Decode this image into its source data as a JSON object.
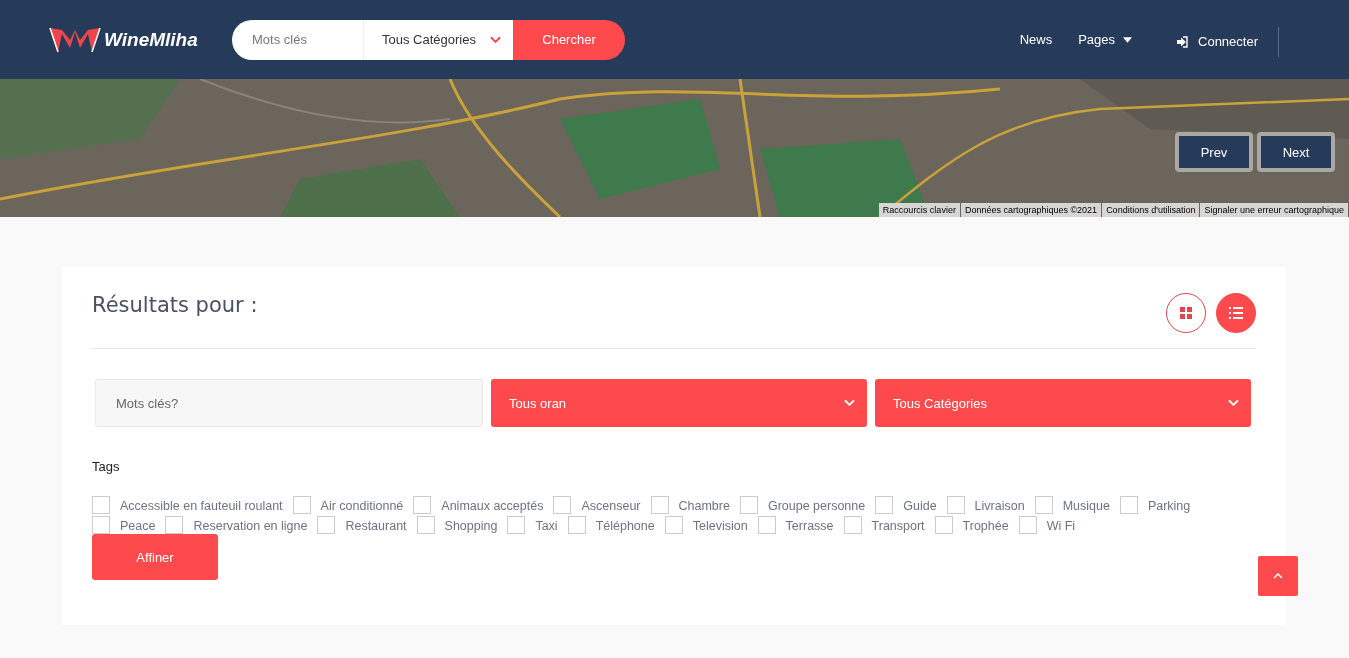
{
  "header": {
    "logo": "WineMliha",
    "search": {
      "placeholder": "Mots clés",
      "category": "Tous Catégories",
      "button": "Chercher"
    },
    "nav": [
      {
        "label": "News",
        "kind": "link"
      },
      {
        "label": "Pages",
        "kind": "dropdown"
      }
    ],
    "login": "Connecter"
  },
  "map": {
    "buttons": [
      "Prev",
      "Next"
    ],
    "attribution": [
      "Raccourcis clavier",
      "Données cartographiques ©2021",
      "Conditions d'utilisation",
      "Signaler une erreur cartographique"
    ]
  },
  "results": {
    "title": "Résultats pour :",
    "views": [
      {
        "kind": "grid",
        "selected": false
      },
      {
        "kind": "list",
        "selected": true
      }
    ],
    "filters": {
      "keyword_placeholder": "Mots clés?",
      "location": "Tous oran",
      "category": "Tous Catégories"
    },
    "tags_label": "Tags",
    "tags": [
      {
        "label": "Accessible en fauteuil roulant",
        "checked": false
      },
      {
        "label": "Air conditionné",
        "checked": false
      },
      {
        "label": "Animaux acceptés",
        "checked": false
      },
      {
        "label": "Ascenseur",
        "checked": false
      },
      {
        "label": "Chambre",
        "checked": false
      },
      {
        "label": "Groupe personne",
        "checked": false
      },
      {
        "label": "Guide",
        "checked": false
      },
      {
        "label": "Livraison",
        "checked": false
      },
      {
        "label": "Musique",
        "checked": false
      },
      {
        "label": "Parking",
        "checked": false
      },
      {
        "label": "Peace",
        "checked": false
      },
      {
        "label": "Reservation en ligne",
        "checked": false
      },
      {
        "label": "Restaurant",
        "checked": false
      },
      {
        "label": "Shopping",
        "checked": false
      },
      {
        "label": "Taxi",
        "checked": false
      },
      {
        "label": "Téléphone",
        "checked": false
      },
      {
        "label": "Television",
        "checked": false
      },
      {
        "label": "Terrasse",
        "checked": false
      },
      {
        "label": "Transport",
        "checked": false
      },
      {
        "label": "Trophée",
        "checked": false
      },
      {
        "label": "Wi Fi",
        "checked": false
      }
    ],
    "submit": "Affiner"
  }
}
